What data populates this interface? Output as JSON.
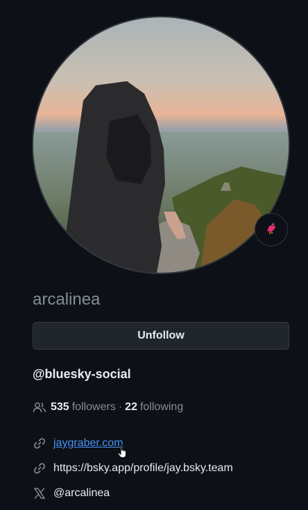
{
  "profile": {
    "username": "arcalinea",
    "unfollow_label": "Unfollow",
    "org_handle": "@bluesky-social",
    "avatar_alt": "avatar-photo",
    "status_icon": "bird-emoji"
  },
  "stats": {
    "followers_count": "535",
    "followers_label": "followers",
    "separator": "·",
    "following_count": "22",
    "following_label": "following"
  },
  "links": {
    "website": "jaygraber.com",
    "bluesky": "https://bsky.app/profile/jay.bsky.team",
    "twitter": "@arcalinea"
  },
  "colors": {
    "background": "#0d1117",
    "link": "#4493f8",
    "muted": "#848d97"
  }
}
